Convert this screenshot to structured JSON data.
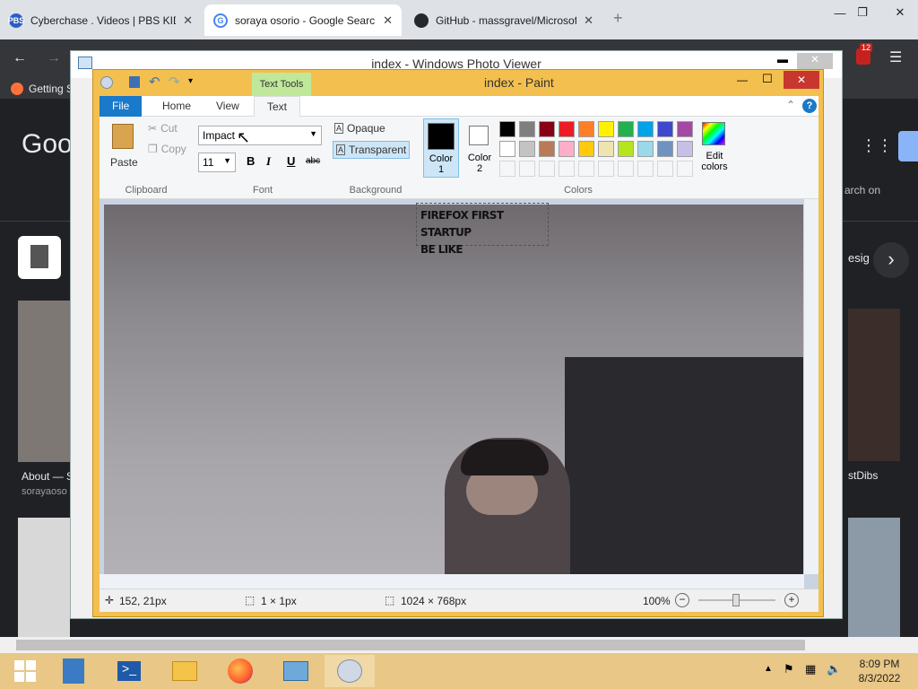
{
  "browser": {
    "tabs": [
      {
        "title": "Cyberchase . Videos | PBS KIDS",
        "fav": "PBS",
        "favcolor": "#2a5ec6"
      },
      {
        "title": "soraya osorio - Google Search",
        "fav": "G",
        "favcolor": "#4285f4"
      },
      {
        "title": "GitHub - massgravel/Microsoft-",
        "fav": "",
        "favcolor": "#24292e"
      }
    ],
    "new_tab": "+",
    "bookmark_label": "Getting S",
    "google_logo": "Goo",
    "search_on": "arch on",
    "result_about": "About — S",
    "result_site": "sorayaoso",
    "result_right_1": "esig",
    "result_right_2": "stDibs",
    "ext_badge": "12"
  },
  "photo_viewer": {
    "title": "index - Windows Photo Viewer"
  },
  "paint": {
    "title": "index - Paint",
    "context_tab": "Text Tools",
    "tabs": [
      "File",
      "Home",
      "View",
      "Text"
    ],
    "clipboard": {
      "paste": "Paste",
      "cut": "Cut",
      "copy": "Copy",
      "label": "Clipboard"
    },
    "font": {
      "family": "Impact",
      "size": "11",
      "bold": "B",
      "italic": "I",
      "underline": "U",
      "strike": "abc",
      "label": "Font"
    },
    "background": {
      "opaque": "Opaque",
      "transparent": "Transparent",
      "label": "Background"
    },
    "colors": {
      "color1": "Color 1",
      "color1_num": "1",
      "color2": "Color 2",
      "color2_num": "2",
      "edit": "Edit colors",
      "label": "Colors",
      "palette_row1": [
        "#000000",
        "#7f7f7f",
        "#880015",
        "#ed1c24",
        "#ff7f27",
        "#fff200",
        "#22b14c",
        "#00a2e8",
        "#3f48cc",
        "#a349a4"
      ],
      "palette_row2": [
        "#ffffff",
        "#c3c3c3",
        "#b97a57",
        "#ffaec9",
        "#ffc90e",
        "#efe4b0",
        "#b5e61d",
        "#99d9ea",
        "#7092be",
        "#c8bfe7"
      ]
    },
    "canvas_text_line1": "FIREFOX FIRST STARTUP",
    "canvas_text_line2": "BE LIKE",
    "status": {
      "position": "152, 21px",
      "selection": "1 × 1px",
      "size": "1024 × 768px",
      "zoom": "100%"
    }
  },
  "taskbar": {
    "time": "8:09 PM",
    "date": "8/3/2022"
  }
}
